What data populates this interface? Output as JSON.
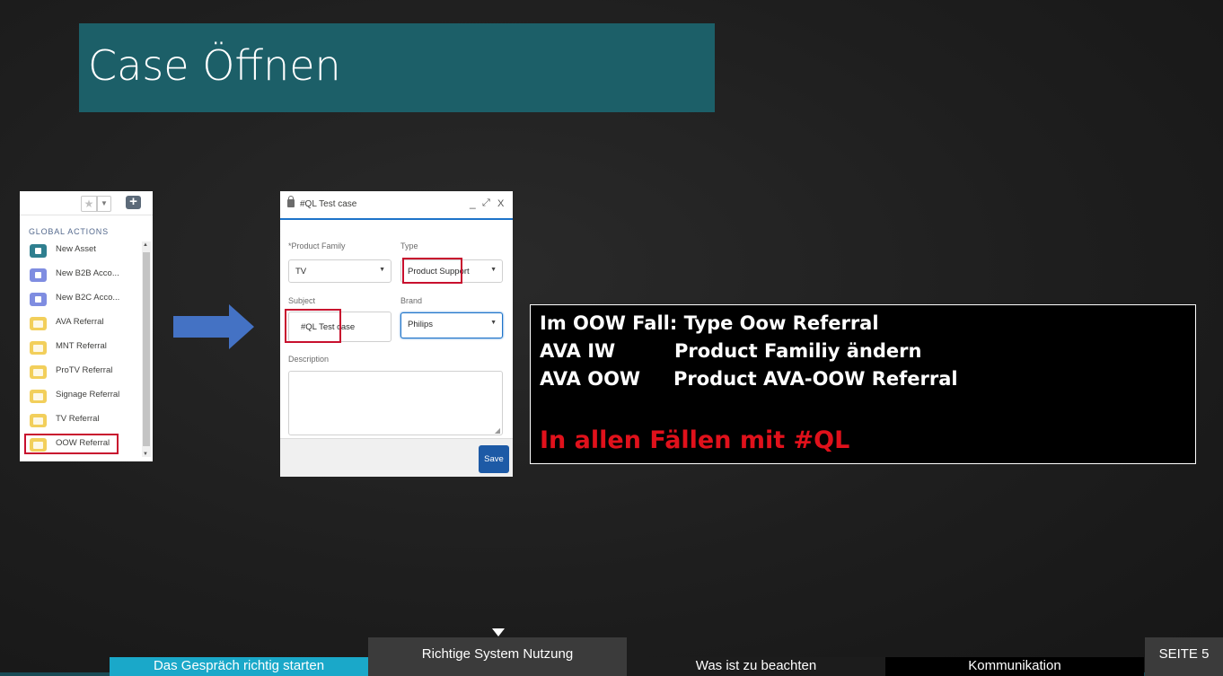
{
  "slide": {
    "title": "Case Öffnen",
    "page_label": "SEITE 5"
  },
  "global_actions": {
    "heading": "GLOBAL ACTIONS",
    "items": [
      {
        "label": "New Asset",
        "icon": "asset-icon",
        "color": "#2f7f8f"
      },
      {
        "label": "New B2B Acco...",
        "icon": "account-icon",
        "color": "#7f8de1"
      },
      {
        "label": "New B2C Acco...",
        "icon": "person-account-icon",
        "color": "#7f8de1"
      },
      {
        "label": "AVA Referral",
        "icon": "folder-icon",
        "color": "#f2cf5b"
      },
      {
        "label": "MNT Referral",
        "icon": "folder-icon",
        "color": "#f2cf5b"
      },
      {
        "label": "ProTV Referral",
        "icon": "folder-icon",
        "color": "#f2cf5b"
      },
      {
        "label": "Signage Referral",
        "icon": "folder-icon",
        "color": "#f2cf5b"
      },
      {
        "label": "TV Referral",
        "icon": "folder-icon",
        "color": "#f2cf5b"
      },
      {
        "label": "OOW Referral",
        "icon": "folder-icon",
        "color": "#f2cf5b"
      }
    ]
  },
  "case_dialog": {
    "title": "#QL Test case",
    "product_family": {
      "label": "*Product Family",
      "value": "TV"
    },
    "type": {
      "label": "Type",
      "value": "Product Support"
    },
    "subject": {
      "label": "Subject",
      "value": "#QL Test case"
    },
    "brand": {
      "label": "Brand",
      "value": "Philips"
    },
    "description": {
      "label": "Description",
      "value": ""
    },
    "save_label": "Save"
  },
  "info": {
    "line1": "Im OOW Fall: Type Oow Referral",
    "line2_a": "AVA IW",
    "line2_b": "Product Familiy ändern",
    "line3_a": "AVA OOW",
    "line3_b": "Product AVA-OOW Referral",
    "highlight": "In allen Fällen mit #QL"
  },
  "nav": {
    "items": [
      {
        "label": "Das Gespräch richtig starten"
      },
      {
        "label": "Richtige System Nutzung",
        "active": true
      },
      {
        "label": "Was ist zu beachten"
      },
      {
        "label": "Kommunikation"
      }
    ]
  },
  "colors": {
    "banner": "#1c5f68",
    "accent_blue": "#1d73c9",
    "highlight_red": "#e0111b",
    "nav_cyan": "#1aa8c9"
  }
}
